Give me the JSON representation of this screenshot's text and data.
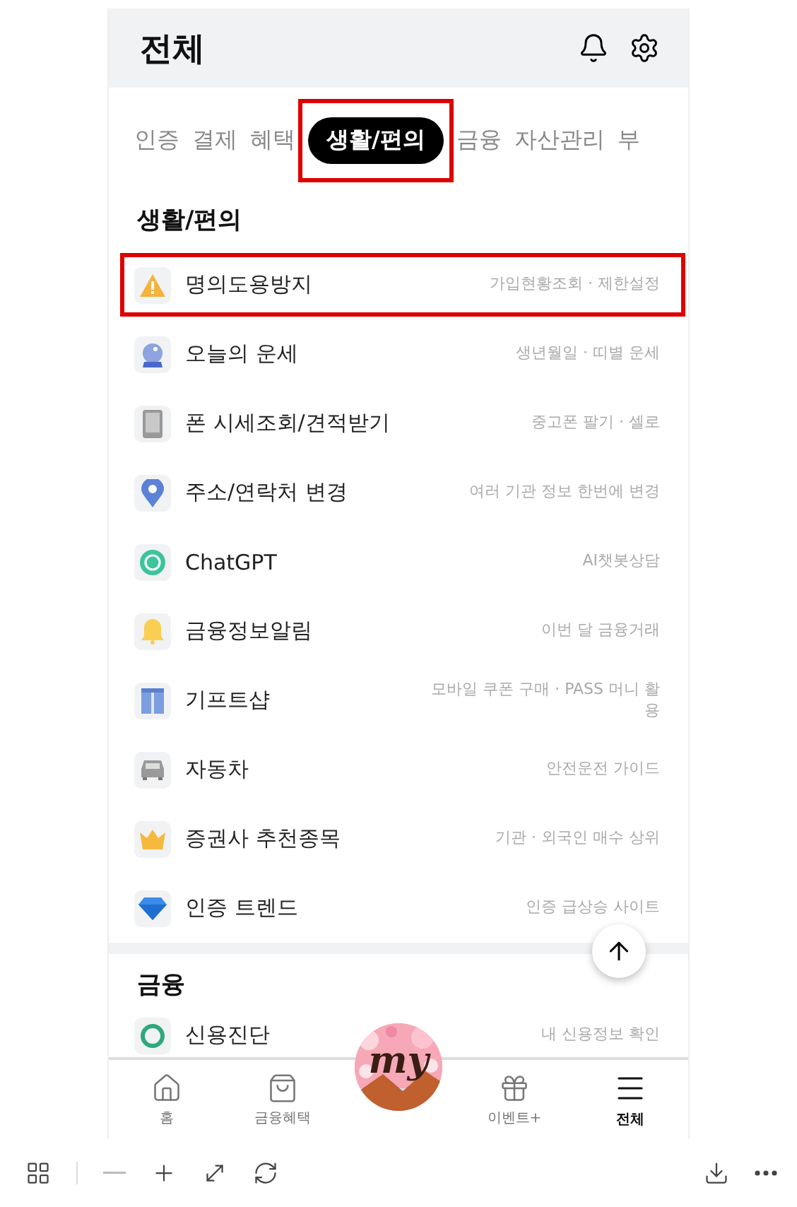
{
  "header": {
    "title": "전체"
  },
  "tabs": [
    {
      "label": "인증",
      "selected": false,
      "highlighted": false
    },
    {
      "label": "결제",
      "selected": false,
      "highlighted": false
    },
    {
      "label": "혜택",
      "selected": false,
      "highlighted": false
    },
    {
      "label": "생활/편의",
      "selected": true,
      "highlighted": true
    },
    {
      "label": "금융",
      "selected": false,
      "highlighted": false
    },
    {
      "label": "자산관리",
      "selected": false,
      "highlighted": false
    },
    {
      "label": "부",
      "selected": false,
      "highlighted": false
    }
  ],
  "sections": [
    {
      "title": "생활/편의",
      "items": [
        {
          "kind": "warning",
          "label": "명의도용방지",
          "detail": "가입현황조회 · 제한설정",
          "highlighted": true
        },
        {
          "kind": "crystal",
          "label": "오늘의 운세",
          "detail": "생년월일 · 띠별 운세",
          "highlighted": false
        },
        {
          "kind": "phone",
          "label": "폰 시세조회/견적받기",
          "detail": "중고폰 팔기 · 셀로",
          "highlighted": false
        },
        {
          "kind": "pin",
          "label": "주소/연락처 변경",
          "detail": "여러 기관 정보 한번에 변경",
          "highlighted": false
        },
        {
          "kind": "chat",
          "label": "ChatGPT",
          "detail": "AI챗봇상담",
          "highlighted": false
        },
        {
          "kind": "bell",
          "label": "금융정보알림",
          "detail": "이번 달 금융거래",
          "highlighted": false
        },
        {
          "kind": "gift",
          "label": "기프트샵",
          "detail": "모바일 쿠폰 구매 · PASS 머니 활용",
          "highlighted": false
        },
        {
          "kind": "car",
          "label": "자동차",
          "detail": "안전운전 가이드",
          "highlighted": false
        },
        {
          "kind": "crown",
          "label": "증권사 추천종목",
          "detail": "기관 · 외국인 매수 상위",
          "highlighted": false
        },
        {
          "kind": "diamond",
          "label": "인증 트렌드",
          "detail": "인증 급상승 사이트",
          "highlighted": false
        }
      ]
    },
    {
      "title": "금융",
      "items": [
        {
          "kind": "gauge",
          "label": "신용진단",
          "detail": "내 신용정보 확인",
          "highlighted": false
        }
      ]
    }
  ],
  "nav": [
    {
      "kind": "home",
      "label": "홈",
      "selected": false
    },
    {
      "kind": "bag",
      "label": "금융혜택",
      "selected": false
    },
    {
      "kind": "my",
      "label": "my",
      "selected": false
    },
    {
      "kind": "gift",
      "label": "이벤트+",
      "selected": false
    },
    {
      "kind": "menu",
      "label": "전체",
      "selected": true
    }
  ],
  "viewer_toolbar": [
    {
      "kind": "grid",
      "disabled": false
    },
    {
      "kind": "minus",
      "disabled": true
    },
    {
      "kind": "plus",
      "disabled": false
    },
    {
      "kind": "expand",
      "disabled": false
    },
    {
      "kind": "refresh",
      "disabled": false
    },
    {
      "kind": "download",
      "disabled": false
    },
    {
      "kind": "more",
      "disabled": false
    }
  ]
}
